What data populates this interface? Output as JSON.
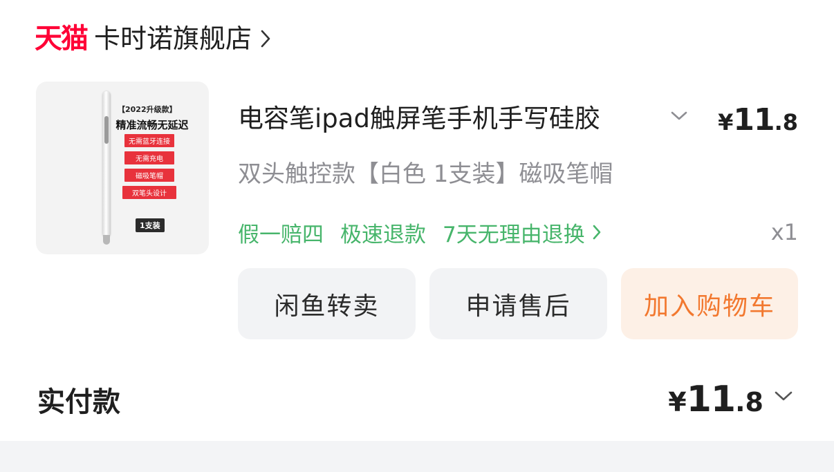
{
  "store": {
    "platform_logo_text": "天猫",
    "name": "卡时诺旗舰店",
    "arrow_icon": "chevron-right-icon"
  },
  "product": {
    "image": {
      "badge_top": "【2022升级款】",
      "headline": "精准流畅无延迟",
      "tags": [
        "无需蓝牙连接",
        "无需充电",
        "磁吸笔帽",
        "双笔头设计"
      ],
      "pack": "1支装"
    },
    "title": "电容笔ipad触屏笔手机手写硅胶",
    "title_expand_icon": "chevron-down-icon",
    "price": {
      "currency": "¥",
      "integer": "11",
      "decimal": ".8"
    },
    "spec": "双头触控款【白色 1支装】磁吸笔帽",
    "services": [
      "假一赔四",
      "极速退款",
      "7天无理由退换"
    ],
    "services_arrow_icon": "chevron-right-icon",
    "quantity": "x1"
  },
  "actions": {
    "resell_label": "闲鱼转卖",
    "aftersale_label": "申请售后",
    "cart_label": "加入购物车"
  },
  "payment": {
    "label": "实付款",
    "amount": {
      "currency": "¥",
      "integer": "11",
      "decimal": ".8"
    },
    "expand_icon": "chevron-down-icon"
  },
  "colors": {
    "tmall_red": "#ff0036",
    "service_green": "#47b56b",
    "cart_orange": "#f2782f",
    "cart_bg": "#fdf0e6",
    "button_bg": "#f2f3f5"
  }
}
